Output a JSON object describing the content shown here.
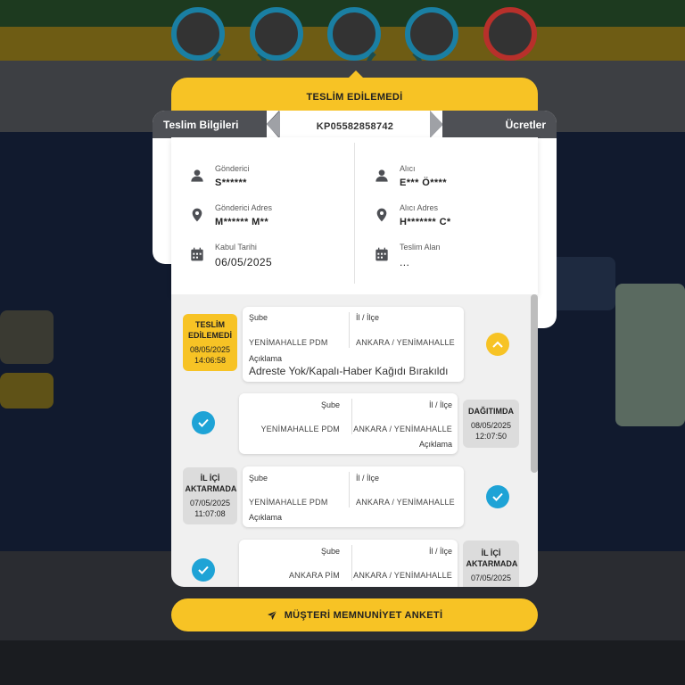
{
  "modal": {
    "status_title": "TESLİM EDİLEMEDİ",
    "tab_left": "Teslim Bilgileri",
    "tab_right": "Ücretler",
    "tracking_number": "KP05582858742",
    "sender": {
      "name_label": "Gönderici",
      "name_value": "S******",
      "address_label": "Gönderici Adres",
      "address_value": "M****** M**",
      "date_label": "Kabul Tarihi",
      "date_value": "06/05/2025"
    },
    "receiver": {
      "name_label": "Alıcı",
      "name_value": "E*** Ö****",
      "address_label": "Alıcı Adres",
      "address_value": "H******* C*",
      "delivered_to_label": "Teslim Alan",
      "delivered_to_value": "..."
    },
    "history": [
      {
        "status": "TESLİM EDİLEMEDİ",
        "date": "08/05/2025",
        "time": "14:06:58",
        "branch_label": "Şube",
        "branch_value": "YENİMAHALLE PDM",
        "city_label": "İl / İlçe",
        "city_value": "ANKARA / YENİMAHALLE",
        "desc_label": "Açıklama",
        "desc_value": "Adreste Yok/Kapalı-Haber Kağıdı Bırakıldı"
      },
      {
        "status": "DAĞITIMDA",
        "date": "08/05/2025",
        "time": "12:07:50",
        "branch_label": "Şube",
        "branch_value": "YENİMAHALLE PDM",
        "city_label": "İl / İlçe",
        "city_value": "ANKARA / YENİMAHALLE",
        "desc_label": "Açıklama"
      },
      {
        "status": "İL İÇİ AKTARMADA",
        "date": "07/05/2025",
        "time": "11:07:08",
        "branch_label": "Şube",
        "branch_value": "YENİMAHALLE PDM",
        "city_label": "İl / İlçe",
        "city_value": "ANKARA / YENİMAHALLE",
        "desc_label": "Açıklama"
      },
      {
        "status": "İL İÇİ AKTARMADA",
        "date": "07/05/2025",
        "branch_label": "Şube",
        "branch_value": "ANKARA PİM",
        "city_label": "İl / İlçe",
        "city_value": "ANKARA / YENİMAHALLE"
      }
    ],
    "survey_button": "MÜŞTERİ MEMNUNİYET ANKETİ"
  },
  "icons": {
    "person": "person-icon",
    "location": "location-pin-icon",
    "calendar": "calendar-icon",
    "check": "check-circle-icon",
    "chevron_up": "chevron-up-icon",
    "send": "paper-plane-icon"
  },
  "colors": {
    "accent_yellow": "#f7c325",
    "tab_gray": "#4e5055",
    "check_blue": "#1ea3d6"
  }
}
